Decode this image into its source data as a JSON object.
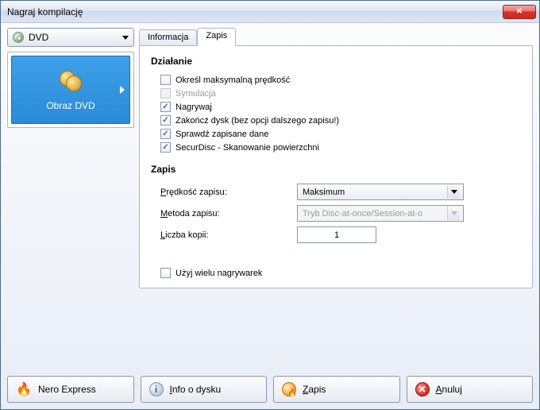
{
  "window": {
    "title": "Nagraj kompilację"
  },
  "drive": {
    "label": "DVD"
  },
  "project": {
    "label": "Obraz DVD"
  },
  "tabs": {
    "info": "Informacja",
    "burn": "Zapis"
  },
  "sections": {
    "action": "Działanie",
    "write": "Zapis"
  },
  "checks": {
    "max_speed": "Określ maksymalną prędkość",
    "simulation": "Symulacja",
    "write": "Nagrywaj",
    "finalize": "Zakończ dysk (bez opcji dalszego zapisu!)",
    "verify": "Sprawdź zapisane dane",
    "securdisc": "SecurDisc - Skanowanie powierzchni",
    "multi_recorder": "Użyj wielu nagrywarek"
  },
  "form": {
    "speed_label": "Prędkość zapisu:",
    "speed_value": "Maksimum",
    "method_label": "Metoda zapisu:",
    "method_value": "Tryb Disc-at-once/Session-at-o",
    "copies_label": "Liczba kopii:",
    "copies_value": "1"
  },
  "buttons": {
    "nero_express": "Nero Express",
    "disc_info": "Info o dysku",
    "burn": "Zapis",
    "cancel": "Anuluj"
  }
}
